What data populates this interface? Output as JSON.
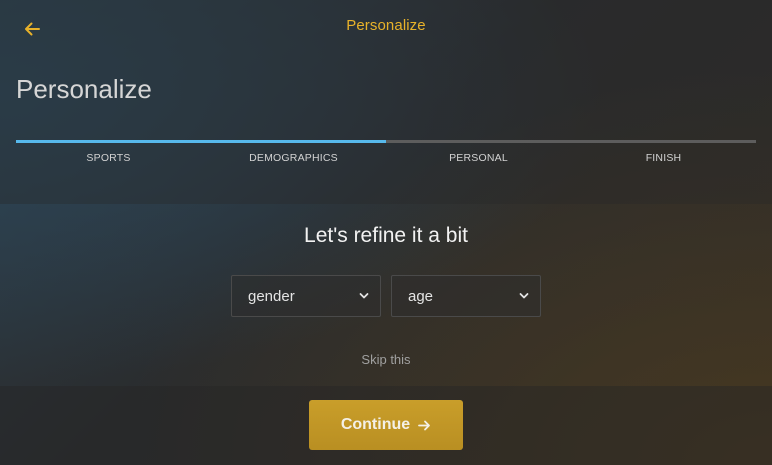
{
  "topbar": {
    "back_icon": "arrow-left-icon",
    "title": "Personalize"
  },
  "page": {
    "title": "Personalize"
  },
  "progress": {
    "fraction": 0.5,
    "steps": [
      {
        "label": "SPORTS"
      },
      {
        "label": "DEMOGRAPHICS"
      },
      {
        "label": "PERSONAL"
      },
      {
        "label": "FINISH"
      }
    ]
  },
  "main": {
    "heading": "Let's refine it a bit",
    "gender_select": {
      "value": "gender",
      "icon": "chevron-down-icon"
    },
    "age_select": {
      "value": "age",
      "icon": "chevron-down-icon"
    },
    "skip_label": "Skip this"
  },
  "footer": {
    "continue_label": "Continue",
    "continue_icon": "arrow-right-icon"
  },
  "colors": {
    "accent": "#e8b22a",
    "progress": "#57b9ec",
    "button": "#c99e2a"
  }
}
